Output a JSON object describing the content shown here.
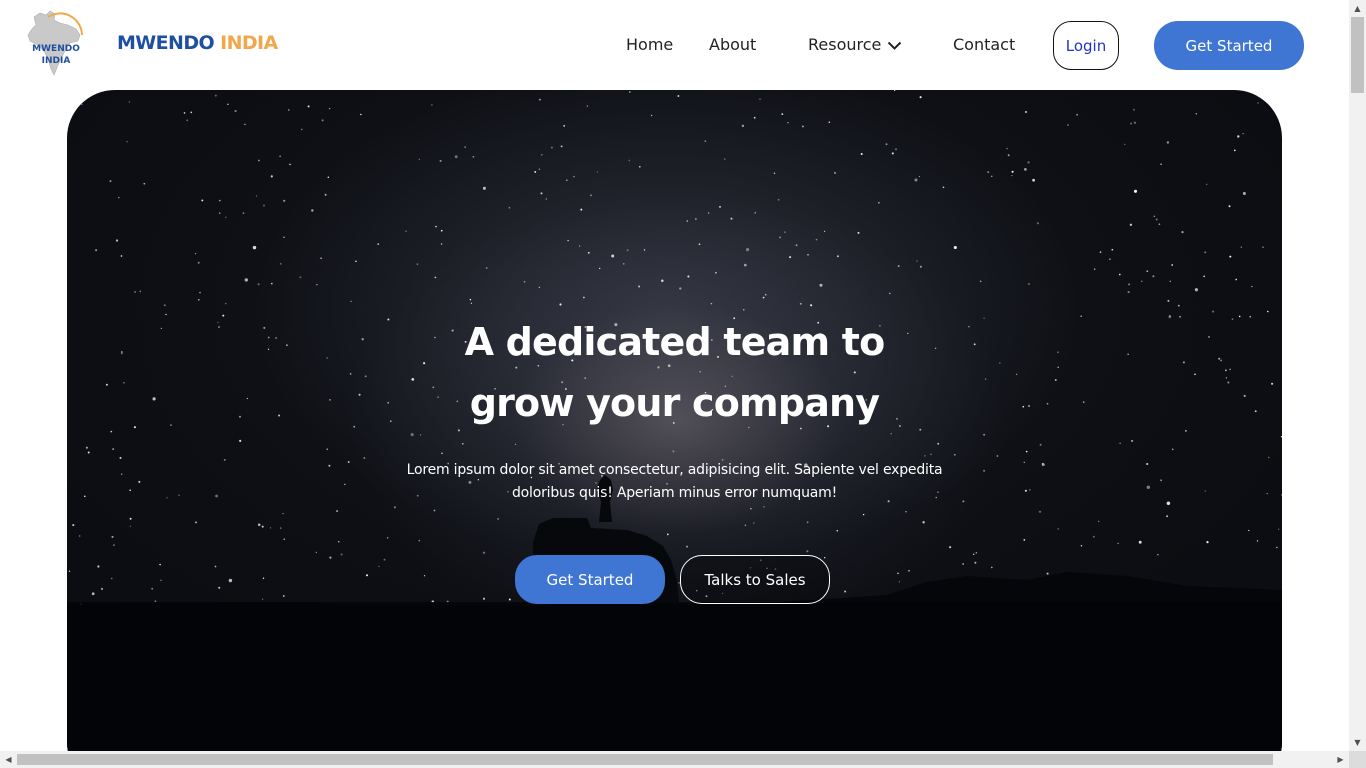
{
  "header": {
    "logo": {
      "line1": "MWENDO",
      "line2": "INDIA"
    },
    "brand": {
      "part1": "MWENDO",
      "part2": "INDIA"
    },
    "nav": {
      "home": "Home",
      "about": "About",
      "resource": "Resource",
      "contact": "Contact"
    },
    "login_label": "Login",
    "get_started_label": "Get Started"
  },
  "hero": {
    "title_line1": "A dedicated team to",
    "title_line2": "grow your company",
    "subtitle_line1": "Lorem ipsum dolor sit amet consectetur, adipisicing elit. Sapiente vel expedita",
    "subtitle_line2": "doloribus quis! Aperiam minus error numquam!",
    "primary_button": "Get Started",
    "secondary_button": "Talks to Sales"
  },
  "icons": {
    "resource_dropdown": "chevron-down-icon",
    "logo": "india-map-icon",
    "scroll_up": "arrow-up-icon",
    "scroll_down": "arrow-down-icon",
    "scroll_left": "arrow-left-icon",
    "scroll_right": "arrow-right-icon"
  },
  "colors": {
    "brand_blue": "#1f4fa0",
    "brand_orange": "#f0a84a",
    "accent_button": "#3f76d4",
    "login_text": "#2233cc",
    "hero_background": "#0b0d12"
  }
}
